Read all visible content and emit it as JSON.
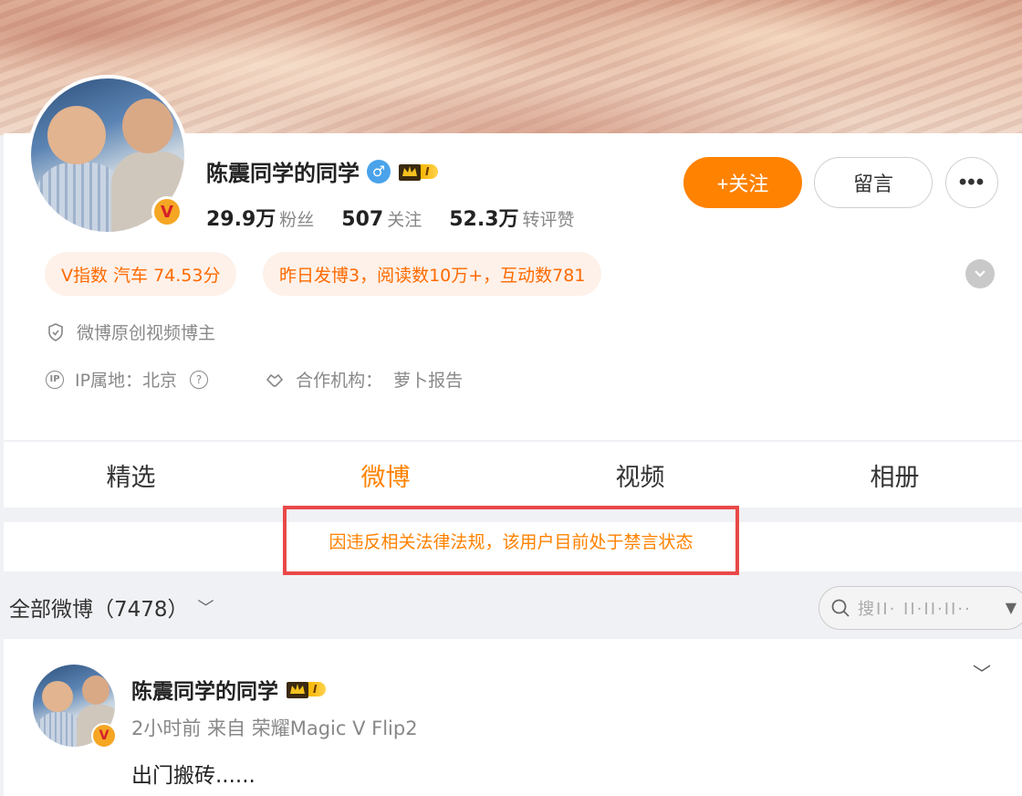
{
  "colors": {
    "accent": "#ff8200",
    "notice_border": "#e94848",
    "pill_bg": "#fdf1e9"
  },
  "profile": {
    "username": "陈震同学的同学",
    "gender_icon": "♂",
    "member_level": "I",
    "verified_badge": "V",
    "stats": [
      {
        "num": "29.9万",
        "label": "粉丝"
      },
      {
        "num": "507",
        "label": "关注"
      },
      {
        "num": "52.3万",
        "label": "转评赞"
      }
    ],
    "follow_label": "+关注",
    "message_label": "留言",
    "more_label": "•••",
    "pills": [
      "V指数 汽车 74.53分",
      "昨日发博3，阅读数10万+，互动数781"
    ],
    "expand_icon": "chevron-down-icon",
    "verified_desc": "微博原创视频博主",
    "ip_label": "IP属地：北京",
    "help_glyph": "?",
    "ip_glyph": "IP",
    "org_label": "合作机构：",
    "org_value": "萝卜报告"
  },
  "tabs": [
    {
      "label": "精选",
      "active": false
    },
    {
      "label": "微博",
      "active": true
    },
    {
      "label": "视频",
      "active": false
    },
    {
      "label": "相册",
      "active": false
    }
  ],
  "notice": "因违反相关法律法规，该用户目前处于禁言状态",
  "filter": {
    "label": "全部微博（7478）",
    "chevron": "﹀",
    "search_placeholder": "搜II· II·II·II··",
    "search_caret": "▼"
  },
  "post": {
    "author": "陈震同学的同学",
    "member_level": "I",
    "verified_badge": "V",
    "meta": "2小时前  来自 荣耀Magic V Flip2",
    "text": "出门搬砖......",
    "chevron": "﹀"
  }
}
